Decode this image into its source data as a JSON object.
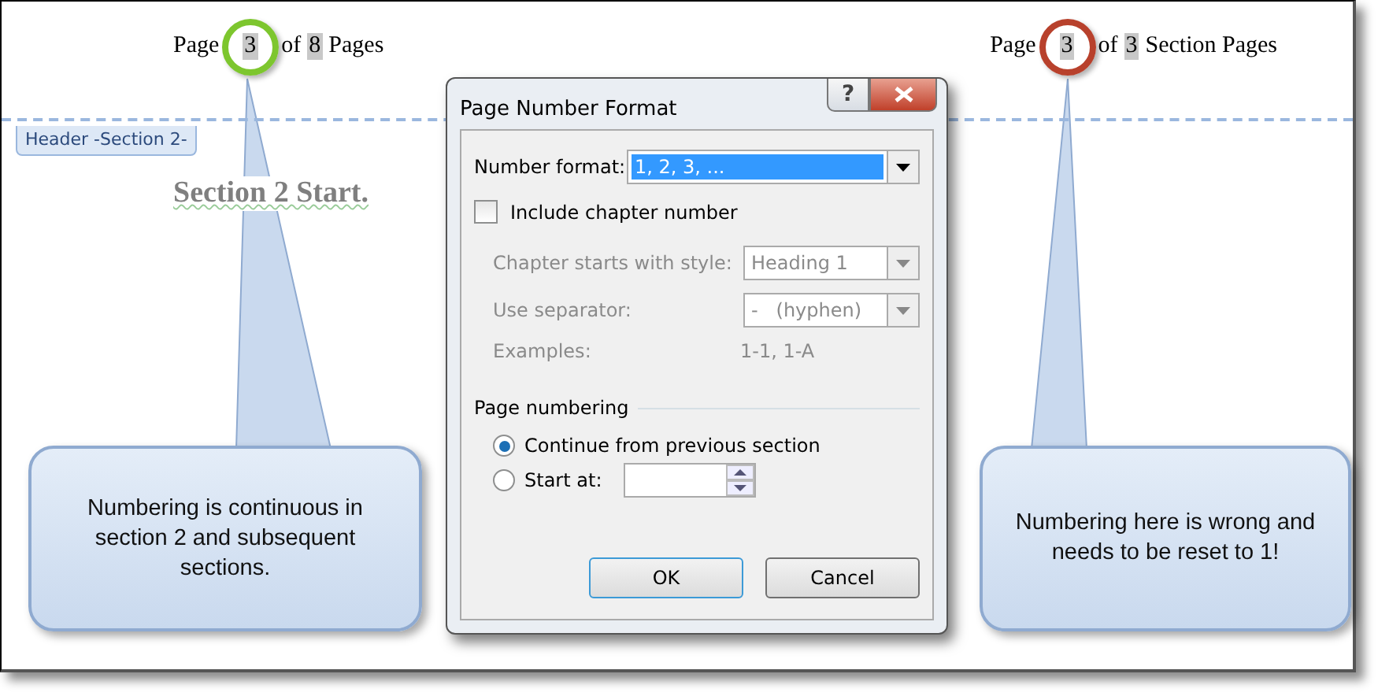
{
  "document": {
    "header_left": {
      "prefix": "Page",
      "page_field": "3",
      "middle": "of",
      "total_field": "8",
      "suffix": "Pages"
    },
    "header_right": {
      "prefix": "Page",
      "page_field": "3",
      "middle": "of",
      "total_field": "3",
      "suffix": "Section Pages"
    },
    "header_tag": "Header -Section 2-",
    "heading": "Section 2 Start."
  },
  "callouts": [
    {
      "text": "Numbering is continuous in section 2 and subsequent sections.",
      "color": "#7dc62e"
    },
    {
      "text": "Numbering here is wrong and needs to be reset to 1!",
      "color": "#b8412c"
    }
  ],
  "dialog": {
    "title": "Page Number Format",
    "help": "?",
    "number_format": {
      "label": "Number format:",
      "value": "1, 2, 3, ..."
    },
    "include_chapter": {
      "label": "Include chapter number",
      "checked": false
    },
    "chapter_style": {
      "label": "Chapter starts with style:",
      "value": "Heading 1",
      "disabled": true
    },
    "separator": {
      "label": "Use separator:",
      "value": "-   (hyphen)",
      "disabled": true
    },
    "examples": {
      "label": "Examples:",
      "value": "1-1, 1-A"
    },
    "group": "Page numbering",
    "radios": [
      {
        "label": "Continue from previous section",
        "selected": true
      },
      {
        "label": "Start at:",
        "selected": false
      }
    ],
    "buttons": [
      {
        "label": "OK",
        "default": true
      },
      {
        "label": "Cancel",
        "default": false
      }
    ]
  }
}
